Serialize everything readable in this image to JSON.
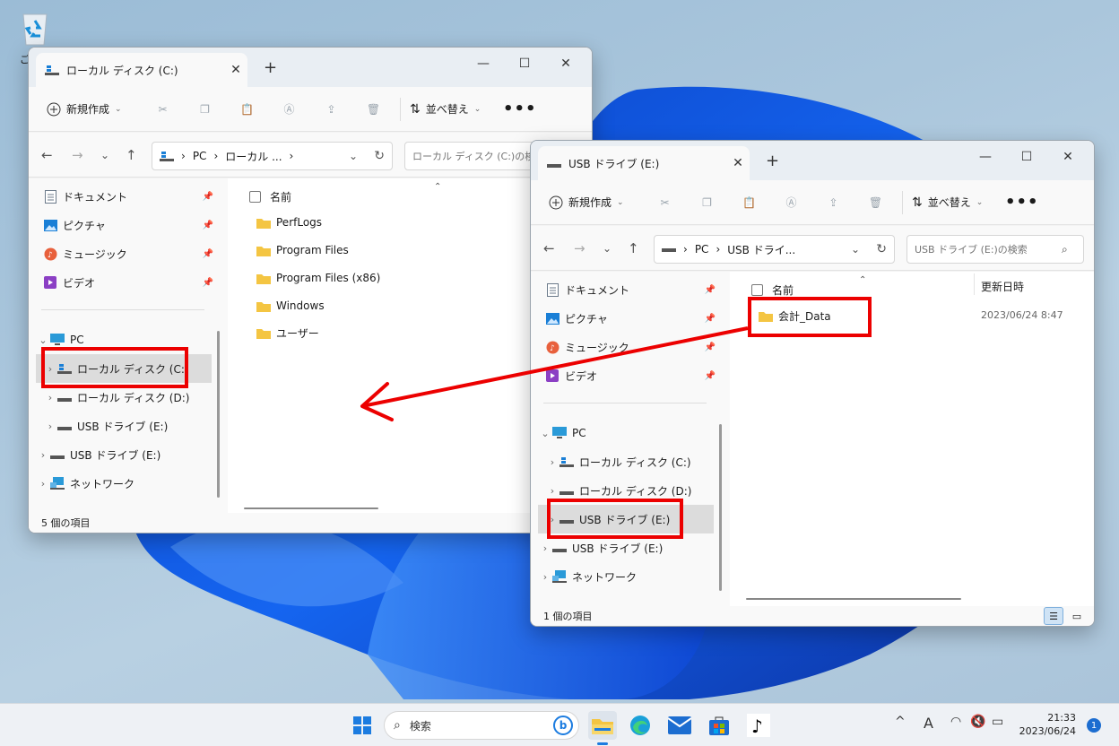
{
  "desktop": {
    "recycle_bin_label": "ご"
  },
  "window_c": {
    "tab_title": "ローカル ディスク (C:)",
    "tab_close": "✕",
    "new_tab": "+",
    "controls": {
      "minimize": "—",
      "maximize": "☐",
      "close": "✕"
    },
    "toolbar": {
      "new_label": "新規作成",
      "sort_label": "並べ替え",
      "more": "•••"
    },
    "address": {
      "pc": "PC",
      "sep": "›",
      "crumb": "ローカル ..."
    },
    "search_placeholder": "ローカル ディスク (C:)の検索",
    "sidebar": {
      "quick": [
        "ドキュメント",
        "ピクチャ",
        "ミュージック",
        "ビデオ"
      ],
      "pc": "PC",
      "drive_c": "ローカル ディスク (C:)",
      "drive_d": "ローカル ディスク (D:)",
      "drive_e": "USB ドライブ (E:)",
      "usb_e": "USB ドライブ (E:)",
      "network": "ネットワーク"
    },
    "column_name": "名前",
    "files": [
      "PerfLogs",
      "Program Files",
      "Program Files (x86)",
      "Windows",
      "ユーザー"
    ],
    "status": "5 個の項目"
  },
  "window_e": {
    "tab_title": "USB ドライブ (E:)",
    "tab_close": "✕",
    "new_tab": "+",
    "controls": {
      "minimize": "—",
      "maximize": "☐",
      "close": "✕"
    },
    "toolbar": {
      "new_label": "新規作成",
      "sort_label": "並べ替え",
      "more": "•••"
    },
    "address": {
      "pc": "PC",
      "sep": "›",
      "crumb": "USB ドライ..."
    },
    "search_placeholder": "USB ドライブ (E:)の検索",
    "sidebar": {
      "quick": [
        "ドキュメント",
        "ピクチャ",
        "ミュージック",
        "ビデオ"
      ],
      "pc": "PC",
      "drive_c": "ローカル ディスク (C:)",
      "drive_d": "ローカル ディスク (D:)",
      "drive_e": "USB ドライブ (E:)",
      "usb_e": "USB ドライブ (E:)",
      "network": "ネットワーク"
    },
    "column_name": "名前",
    "column_date": "更新日時",
    "files": [
      {
        "name": "会計_Data",
        "date": "2023/06/24 8:47"
      }
    ],
    "status": "1 個の項目"
  },
  "taskbar": {
    "search_label": "検索",
    "clock_time": "21:33",
    "clock_date": "2023/06/24",
    "notification_count": "1",
    "ime": "A",
    "tray_caret": "^"
  },
  "colors": {
    "annotation": "#ec0000",
    "accent": "#1c7ce0",
    "folder": "#f4c542"
  }
}
